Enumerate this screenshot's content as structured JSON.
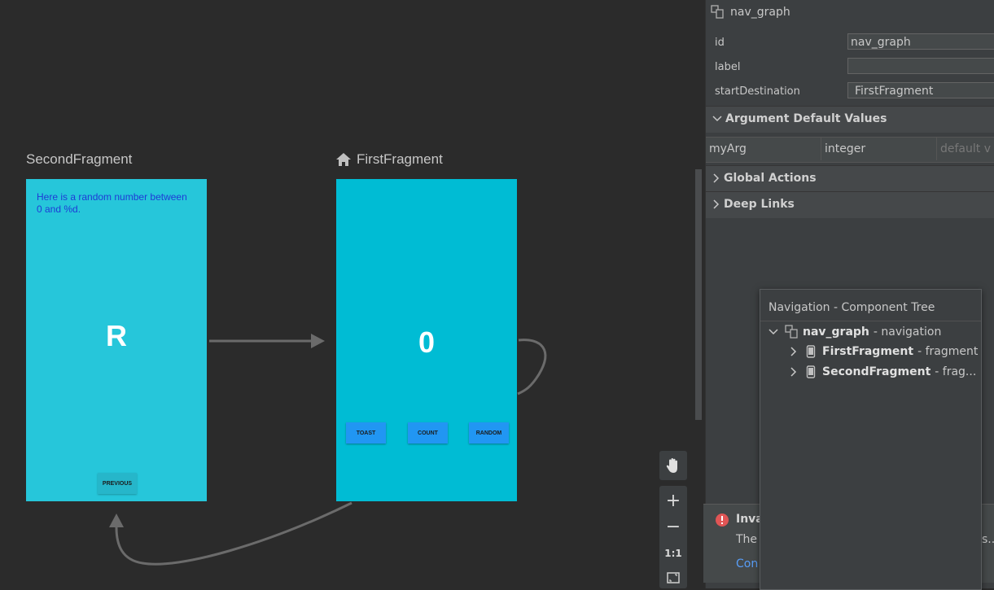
{
  "canvas": {
    "second_fragment": {
      "title": "SecondFragment",
      "text": "Here is a random number between 0 and %d.",
      "big_text": "R",
      "button": "PREVIOUS"
    },
    "first_fragment": {
      "title": "FirstFragment",
      "big_text": "0",
      "buttons": [
        "TOAST",
        "COUNT",
        "RANDOM"
      ]
    },
    "zoom_controls": {
      "fit_label": "1:1"
    },
    "colors": {
      "second_bg": "#26c6da",
      "first_bg": "#00bcd4",
      "button_bg": "#2196f3",
      "arrow": "#6b6b6b"
    }
  },
  "attributes": {
    "header_title": "nav_graph",
    "fields": [
      {
        "label": "id",
        "value": "nav_graph"
      },
      {
        "label": "label",
        "value": ""
      },
      {
        "label": "startDestination",
        "value": "FirstFragment"
      }
    ],
    "sections": {
      "argument_defaults": "Argument Default Values",
      "global_actions": "Global Actions",
      "deep_links": "Deep Links"
    },
    "argument": {
      "name": "myArg",
      "type": "integer",
      "default_placeholder": "default v"
    }
  },
  "error": {
    "title": "Inva",
    "body_start": "The",
    "body_end": "s..",
    "link": "Con"
  },
  "component_tree": {
    "title": "Navigation - Component Tree",
    "root": {
      "name": "nav_graph",
      "kind": "- navigation"
    },
    "children": [
      {
        "name": "FirstFragment",
        "kind": "- fragment"
      },
      {
        "name": "SecondFragment",
        "kind": "- frag..."
      }
    ]
  }
}
